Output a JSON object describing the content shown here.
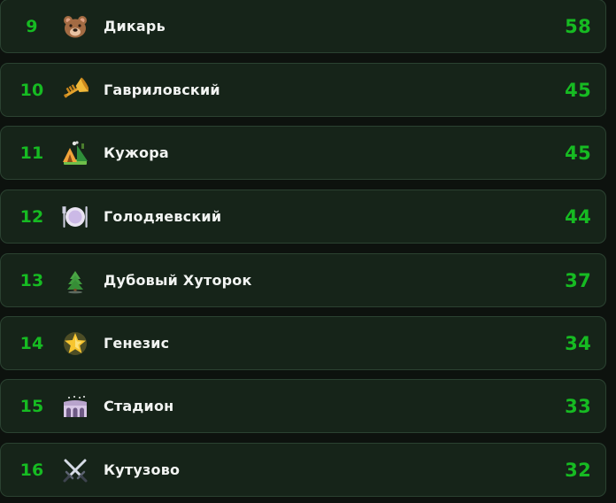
{
  "leaderboard": {
    "rows": [
      {
        "rank": "9",
        "icon": "bear-icon",
        "name": "Дикарь",
        "score": "58"
      },
      {
        "rank": "10",
        "icon": "trumpet-icon",
        "name": "Гавриловский",
        "score": "45"
      },
      {
        "rank": "11",
        "icon": "camping-icon",
        "name": "Кужора",
        "score": "45"
      },
      {
        "rank": "12",
        "icon": "plate-icon",
        "name": "Голодяевский",
        "score": "44"
      },
      {
        "rank": "13",
        "icon": "evergreen-tree-icon",
        "name": "Дубовый Хуторок",
        "score": "37"
      },
      {
        "rank": "14",
        "icon": "glowing-star-icon",
        "name": "Генезис",
        "score": "34"
      },
      {
        "rank": "15",
        "icon": "stadium-icon",
        "name": "Стадион",
        "score": "33"
      },
      {
        "rank": "16",
        "icon": "crossed-swords-icon",
        "name": "Кутузово",
        "score": "32"
      }
    ]
  },
  "colors": {
    "accent": "#16bb22",
    "row_background": "#162419",
    "row_border": "#2b4231",
    "page_background": "#0d120e",
    "text": "#f2f4f2"
  }
}
